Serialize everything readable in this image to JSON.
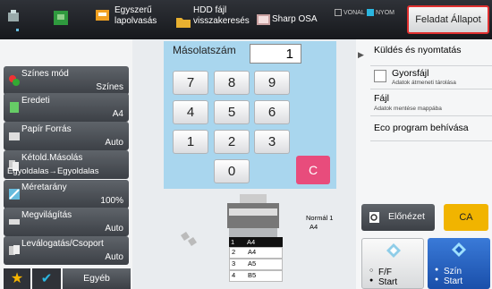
{
  "topbar": {
    "tab_easy_scan": "Egyszerű lapolvasás",
    "tab_hdd": "HDD fájl visszakeresés",
    "tab_sharp_osa": "Sharp OSA",
    "indicator_vonal": "VONAL",
    "indicator_nyom": "NYOM",
    "job_status_label": "Feladat Állapot"
  },
  "copy": {
    "count_label": "Másolatszám",
    "count_value": "1",
    "keys": [
      "7",
      "8",
      "9",
      "4",
      "5",
      "6",
      "1",
      "2",
      "3",
      "0"
    ],
    "clear_label": "C"
  },
  "left_menu": [
    {
      "label": "Színes mód",
      "value": "Színes"
    },
    {
      "label": "Eredeti",
      "value": "A4"
    },
    {
      "label": "Papír Forrás",
      "value": "Auto"
    },
    {
      "label": "Kétold.Másolás",
      "value": "Egyoldalas→Egyoldalas"
    },
    {
      "label": "Méretarány",
      "value": "100%"
    },
    {
      "label": "Megvilágítás",
      "value": "Auto"
    },
    {
      "label": "Leválogatás/Csoport",
      "value": "Auto"
    }
  ],
  "bottom_left": {
    "other_label": "Egyéb"
  },
  "printer": {
    "status_label": "Normál 1",
    "status_sub": "A4",
    "trays": [
      {
        "num": "1",
        "size": "A4"
      },
      {
        "num": "2",
        "size": "A4"
      },
      {
        "num": "3",
        "size": "A5"
      },
      {
        "num": "4",
        "size": "B5"
      }
    ]
  },
  "right_panel": {
    "send_print": "Küldés és nyomtatás",
    "quick_file": "Gyorsfájl",
    "quick_file_sub": "Adatok átmeneti tárolása",
    "file": "Fájl",
    "file_sub": "Adatok mentése mappába",
    "eco": "Eco program behívása"
  },
  "actions": {
    "preview": "Előnézet",
    "ca": "CA",
    "bw_label": "F/F",
    "bw_start": "Start",
    "color_label": "Szín",
    "color_start": "Start"
  },
  "colors": {
    "accent_red": "#e03030",
    "ca_yellow": "#f1b400",
    "clear_pink": "#e84c7c",
    "start_blue": "#1e5fc0"
  }
}
